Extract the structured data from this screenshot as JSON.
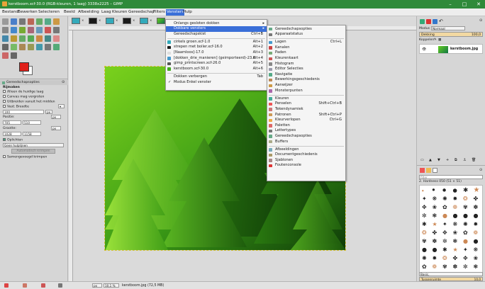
{
  "window": {
    "title": "kerstboom.xcf-30.0 (RGB-kleuren, 1 laag) 3338x2225 – GIMP",
    "controls": {
      "minimize": "–",
      "maximize": "□",
      "close": "✕"
    }
  },
  "menubar": [
    "Bestand",
    "Bewerken",
    "Selecteren",
    "Beeld",
    "Afbeelding",
    "Laag",
    "Kleuren",
    "Gereedschap",
    "Filters",
    "Vensters",
    "Hulp"
  ],
  "menubar_active": "Vensters",
  "vensters_menu": [
    {
      "label": "Onlangs gesloten dokken",
      "shortcut": "",
      "submenu": true
    },
    {
      "label": "Dokbare vensters",
      "shortcut": "",
      "submenu": true,
      "highlighted": true
    },
    {
      "label": "Gereedschapskist",
      "shortcut": "Ctrl+B"
    },
    {
      "sep": true
    },
    {
      "label": "cirkels groen.xcf-1.0",
      "shortcut": "Alt+1",
      "icon": "thumb-icon"
    },
    {
      "label": "strepen met boiler.xcf-16.0",
      "shortcut": "Alt+2",
      "icon": "thumb-icon"
    },
    {
      "label": "[Naamloos]-17.0",
      "shortcut": "Alt+3",
      "icon": "thumb-icon"
    },
    {
      "label": "[dokken_drie_manieren] (geimporteerd)-23.0",
      "shortcut": "Alt+4",
      "icon": "thumb-icon"
    },
    {
      "label": "gimp_printscreen.xcf-26.0",
      "shortcut": "Alt+5",
      "icon": "thumb-icon"
    },
    {
      "label": "kerstboom.xcf-30.0",
      "shortcut": "Alt+6",
      "icon": "thumb-icon"
    },
    {
      "sep": true
    },
    {
      "label": "Dokken verbergen",
      "shortcut": "Tab"
    },
    {
      "label": "Modus Enkel venster",
      "shortcut": "",
      "checked": true
    }
  ],
  "dokbare_menu": [
    {
      "label": "Gereedschapsopties",
      "shortcut": "",
      "icon": "tool-options-icon"
    },
    {
      "label": "Apparaatstatus",
      "shortcut": "",
      "icon": "device-icon"
    },
    {
      "sep": true
    },
    {
      "label": "Lagen",
      "shortcut": "Ctrl+L",
      "icon": "layers-icon"
    },
    {
      "label": "Kanalen",
      "shortcut": "",
      "icon": "channels-icon"
    },
    {
      "label": "Paden",
      "shortcut": "",
      "icon": "paths-icon"
    },
    {
      "label": "Kleurenkaart",
      "shortcut": "",
      "icon": "colormap-icon"
    },
    {
      "label": "Histogram",
      "shortcut": "",
      "icon": "histogram-icon"
    },
    {
      "label": "Editor Selecties",
      "shortcut": "",
      "icon": "selection-editor-icon"
    },
    {
      "label": "Navigatie",
      "shortcut": "",
      "icon": "navigation-icon"
    },
    {
      "label": "Bewerkingsgeschiedenis",
      "shortcut": "",
      "icon": "undo-history-icon"
    },
    {
      "label": "Aanwijzer",
      "shortcut": "",
      "icon": "pointer-icon"
    },
    {
      "label": "Monsterpunten",
      "shortcut": "",
      "icon": "sample-points-icon"
    },
    {
      "sep": true
    },
    {
      "label": "Kleuren",
      "shortcut": "",
      "icon": "colors-icon"
    },
    {
      "label": "Penselen",
      "shortcut": "Shift+Ctrl+B",
      "icon": "brushes-icon"
    },
    {
      "label": "Tekendynamiek",
      "shortcut": "",
      "icon": "dynamics-icon"
    },
    {
      "label": "Patronen",
      "shortcut": "Shift+Ctrl+P",
      "icon": "patterns-icon"
    },
    {
      "label": "Kleurverlopen",
      "shortcut": "Ctrl+G",
      "icon": "gradients-icon"
    },
    {
      "label": "Paletten",
      "shortcut": "",
      "icon": "palettes-icon"
    },
    {
      "label": "Lettertypes",
      "shortcut": "",
      "icon": "fonts-icon"
    },
    {
      "label": "Gereedschapsopties",
      "shortcut": "",
      "icon": "tool-presets-icon"
    },
    {
      "label": "Buffers",
      "shortcut": "",
      "icon": "buffers-icon"
    },
    {
      "sep": true
    },
    {
      "label": "Afbeeldingen",
      "shortcut": "",
      "icon": "images-icon"
    },
    {
      "label": "Documentgeschiedenis",
      "shortcut": "",
      "icon": "document-history-icon"
    },
    {
      "label": "Sjablonen",
      "shortcut": "",
      "icon": "templates-icon"
    },
    {
      "label": "Foutenconsole",
      "shortcut": "",
      "icon": "error-console-icon"
    }
  ],
  "tool_options": {
    "header": "Gereedschapsopties",
    "section": "Rijmaken",
    "options": [
      {
        "label": "Alleen de huidige laag",
        "checked": false
      },
      {
        "label": "Canvas mag vergroten",
        "checked": false
      },
      {
        "label": "Uitbreiden vanuit het midden",
        "checked": false
      }
    ],
    "vast_label": "Vast: Breedte",
    "vast_value": "100",
    "positie_label": "Positie:",
    "positie_unit": "px",
    "positie_x": "705",
    "positie_y": "510",
    "grootte_label": "Grootte:",
    "grootte_unit": "px",
    "grootte_w": "1028",
    "grootte_h": "1158",
    "highlight_label": "Oplichten",
    "guides_label": "Geen hulplijnen",
    "auto_shrink": "Automatisch krimpen",
    "merged_label": "Samengevoegd krimpen"
  },
  "layers_panel": {
    "mode_label": "Modus",
    "mode_value": "Normaal",
    "opacity_label": "Dekking",
    "opacity_value": "100,0",
    "lock_label": "Koppelen:",
    "layer_name": "kerstboom.jpg"
  },
  "brushes_panel": {
    "filter_label": "filter",
    "brush_name": "2. Hardness 050 (51 × 51)",
    "preset_label": "Basic,",
    "spacing_label": "Tussenruimte",
    "spacing_value": "10,0"
  },
  "statusbar": {
    "unit": "px",
    "zoom": "10,1 %",
    "info": "kerstboom.jpg (72,5 MB)"
  },
  "colors": {
    "fg": "#e0201a",
    "bg": "#ffffff",
    "title_bg": "#2f8a3a",
    "highlight": "#3a6fd8"
  }
}
